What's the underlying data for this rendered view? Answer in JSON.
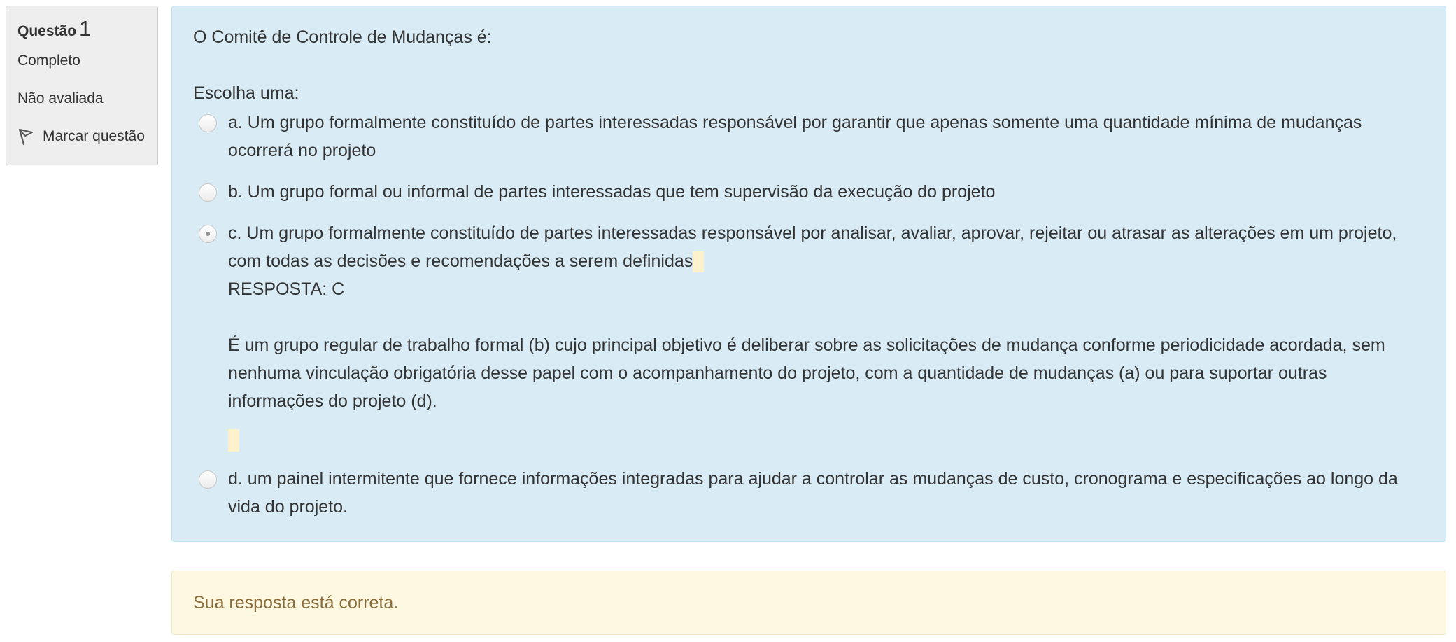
{
  "info": {
    "question_label": "Questão",
    "question_number": "1",
    "state": "Completo",
    "grade": "Não avaliada",
    "flag_label": "Marcar questão",
    "flag_icon": "flag-icon"
  },
  "question": {
    "text": "O Comitê de Controle de Mudanças é:",
    "prompt": "Escolha uma:",
    "options": [
      {
        "text": "a. Um grupo formalmente constituído de partes interessadas responsável por garantir que apenas somente uma quantidade mínima de mudanças ocorrerá no projeto",
        "selected": false
      },
      {
        "text": "b. Um grupo formal ou informal de partes interessadas que tem supervisão da execução do projeto",
        "selected": false
      },
      {
        "text": "c. Um grupo formalmente constituído de partes interessadas responsável por analisar, avaliar, aprovar, rejeitar ou atrasar as alterações em um projeto, com todas as decisões e recomendações a serem definidas",
        "selected": true,
        "answer_line": "RESPOSTA: C",
        "explanation": "É um grupo regular de trabalho formal (b) cujo principal objetivo é deliberar sobre as solicitações de mudança conforme periodicidade acordada, sem nenhuma vinculação obrigatória desse papel com o acompanhamento do projeto, com a quantidade de mudanças (a) ou para suportar outras informações do projeto (d)."
      },
      {
        "text": "d. um painel intermitente que fornece informações integradas para ajudar a controlar as mudanças de custo, cronograma e especificações ao longo da vida do projeto.",
        "selected": false
      }
    ]
  },
  "feedback": {
    "text": "Sua resposta está correta."
  },
  "colors": {
    "formulation_bg": "#d9ebf5",
    "info_bg": "#eeeeee",
    "feedback_bg": "#fcf8e2",
    "feedback_text": "#8a6d3b",
    "highlight": "#fdf2cd"
  }
}
